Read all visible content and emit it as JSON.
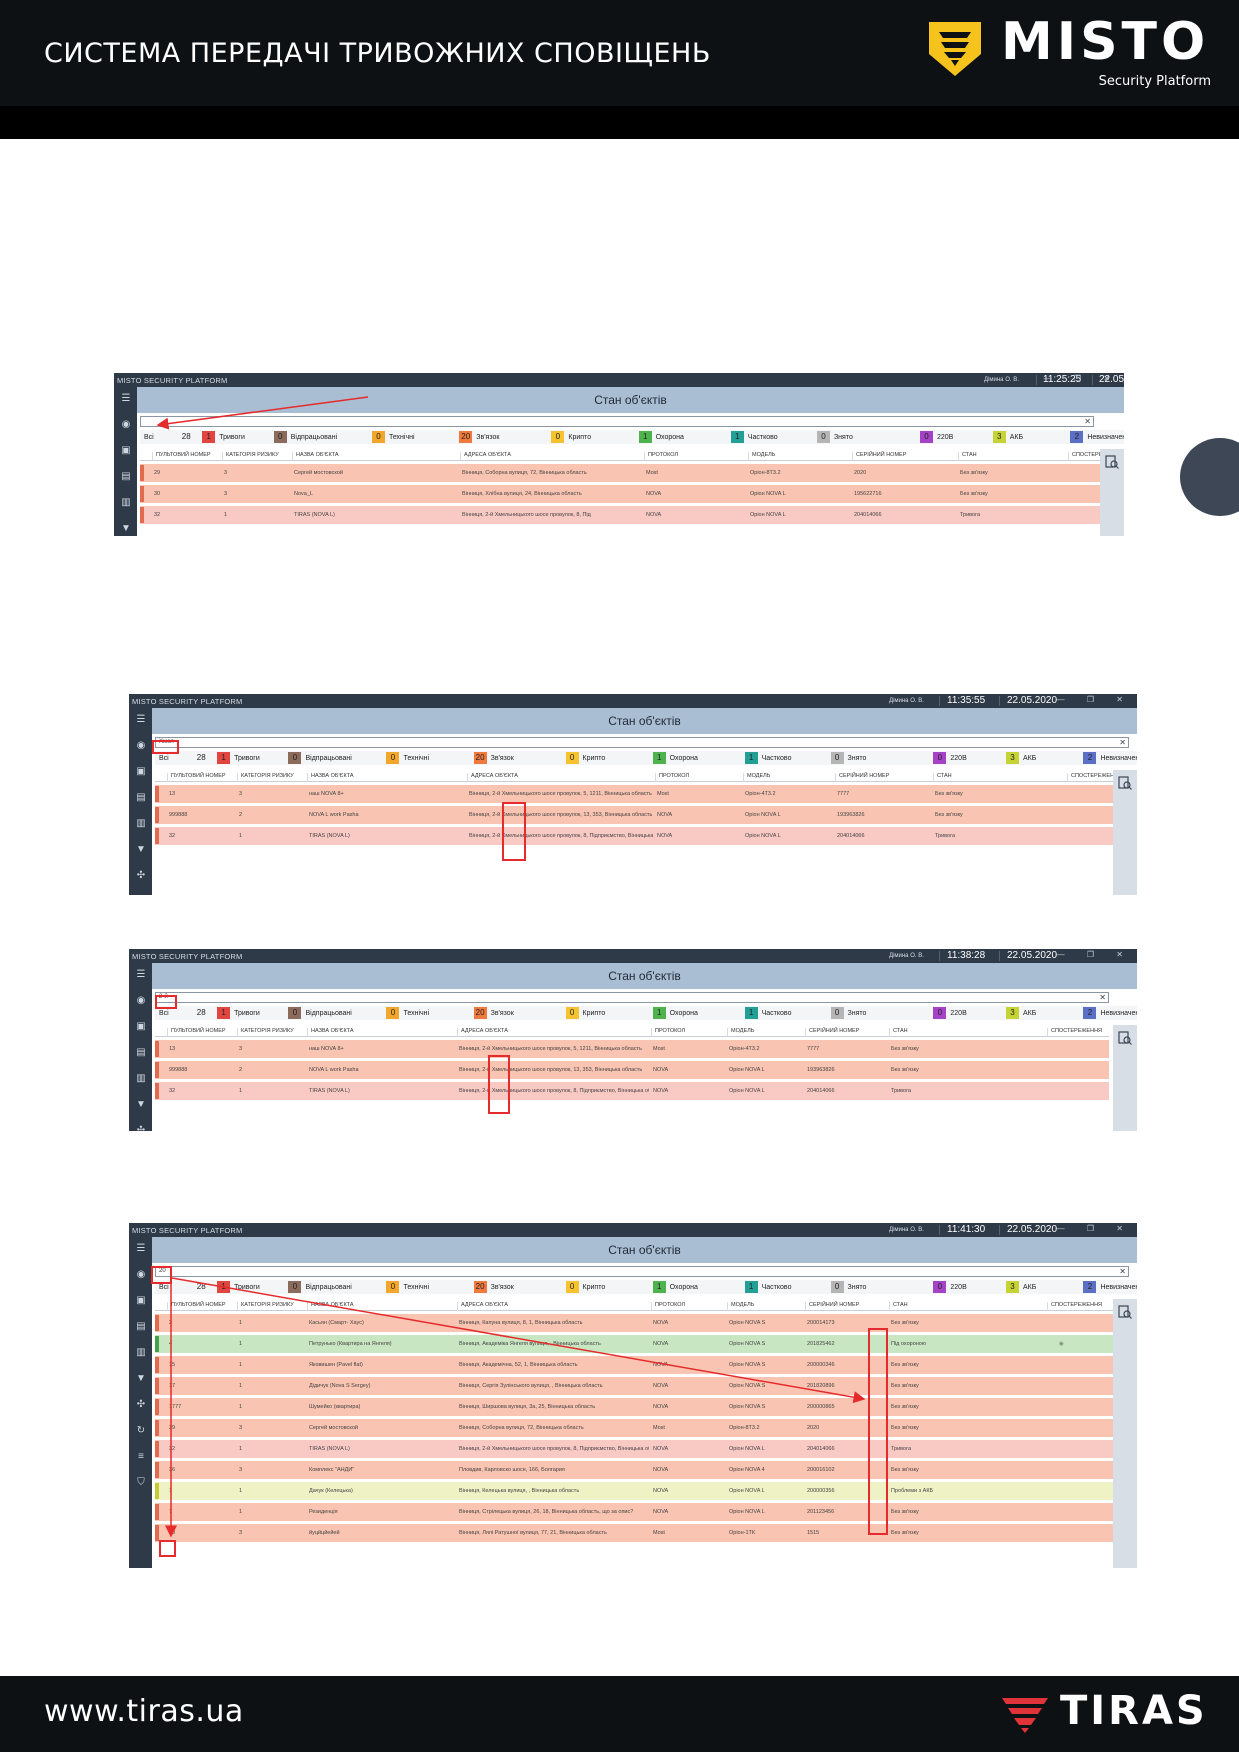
{
  "header": {
    "title": "СИСТЕМА ПЕРЕДАЧІ ТРИВОЖНИХ СПОВІЩЕНЬ",
    "brand": "MISTO",
    "brand_sub": "Security Platform"
  },
  "footer": {
    "url": "www.tiras.ua",
    "brand": "TIRAS"
  },
  "app_common": {
    "app_name": "MISTO SECURITY PLATFORM",
    "user": "Дімина О. В.",
    "date": "22.05.2020",
    "heading": "Стан об'єктів",
    "window_buttons": "— ❐ ✕",
    "clear_icon": "✕",
    "counters": [
      {
        "label": "Всі",
        "value": "28",
        "color": "#f3f5f7"
      },
      {
        "label": "Тривоги",
        "value": "1",
        "color": "#e0453f"
      },
      {
        "label": "Відпрацьовані",
        "value": "0",
        "color": "#8a6b5c"
      },
      {
        "label": "Технічні",
        "value": "0",
        "color": "#f2a62b"
      },
      {
        "label": "Зв'язок",
        "value": "20",
        "color": "#f07a3e"
      },
      {
        "label": "Крипто",
        "value": "0",
        "color": "#f6c22e"
      },
      {
        "label": "Охорона",
        "value": "1",
        "color": "#4fb34d"
      },
      {
        "label": "Частково",
        "value": "1",
        "color": "#22a096"
      },
      {
        "label": "Знято",
        "value": "0",
        "color": "#b5b5b5"
      },
      {
        "label": "220В",
        "value": "0",
        "color": "#a543c7"
      },
      {
        "label": "АКБ",
        "value": "3",
        "color": "#c5d334"
      },
      {
        "label": "Невизначено",
        "value": "2",
        "color": "#5b6fc5"
      }
    ],
    "columns": [
      "ПУЛЬТОВИЙ НОМЕР",
      "КАТЕГОРІЯ РИЗИКУ",
      "НАЗВА ОБ'ЄКТА",
      "АДРЕСА ОБ'ЄКТА",
      "ПРОТОКОЛ",
      "МОДЕЛЬ",
      "СЕРІЙНИЙ НОМЕР",
      "СТАН",
      "СПОСТЕРЕЖЕННЯ"
    ]
  },
  "screens": [
    {
      "time": "11:25:25",
      "search": "",
      "rows": [
        {
          "num": "29",
          "risk": "3",
          "name": "Сергей мостовской",
          "addr": "Вінниця, Соборна вулиця, 72, Вінницька область",
          "proto": "Most",
          "model": "Оріон-8Т3.2",
          "serial": "2020",
          "state": "Без зв'язку",
          "type": "noconn"
        },
        {
          "num": "30",
          "risk": "3",
          "name": "Nova_L",
          "addr": "Вінниця, Хлібна вулиця, 24, Вінницька область",
          "proto": "NOVA",
          "model": "Оріон NOVA L",
          "serial": "195622716",
          "state": "Без зв'язку",
          "type": "noconn"
        },
        {
          "num": "32",
          "risk": "1",
          "name": "TIRAS (NOVA L)",
          "addr": "Вінниця, 2-й Хмельницького шосе провулок, 8, Під",
          "proto": "NOVA",
          "model": "Оріон NOVA L",
          "serial": "204014066",
          "state": "Тривога",
          "type": "alarm"
        }
      ]
    },
    {
      "time": "11:35:55",
      "search": "Хмел",
      "rows": [
        {
          "num": "13",
          "risk": "3",
          "name": "наш NOVA 8+",
          "addr": "Вінниця, 2-й Хмельницького шосе провулок, 5, 1211, Вінницька область",
          "proto": "Most",
          "model": "Оріон-4Т3.2",
          "serial": "7777",
          "state": "Без зв'язку",
          "type": "noconn"
        },
        {
          "num": "999888",
          "risk": "2",
          "name": "NOVA L work Pasha",
          "addr": "Вінниця, 2-й Хмельницького шосе провулок, 13, 353, Вінницька область",
          "proto": "NOVA",
          "model": "Оріон NOVA L",
          "serial": "193963826",
          "state": "Без зв'язку",
          "type": "noconn"
        },
        {
          "num": "32",
          "risk": "1",
          "name": "TIRAS (NOVA L)",
          "addr": "Вінниця, 2-й Хмельницького шосе провулок, 8, Підприємство, Вінницька об",
          "proto": "NOVA",
          "model": "Оріон NOVA L",
          "serial": "204014066",
          "state": "Тривога",
          "type": "alarm"
        }
      ]
    },
    {
      "time": "11:38:28",
      "search": "2-й",
      "rows": [
        {
          "num": "13",
          "risk": "3",
          "name": "наш NOVA 8+",
          "addr": "Вінниця, 2-й Хмельницького шосе провулок, 5, 1211, Вінницька область",
          "proto": "Most",
          "model": "Оріон-4Т3.2",
          "serial": "7777",
          "state": "Без зв'язку",
          "type": "noconn"
        },
        {
          "num": "999888",
          "risk": "2",
          "name": "NOVA L work Pasha",
          "addr": "Вінниця, 2-й Хмельницького шосе провулок, 13, 353, Вінницька область",
          "proto": "NOVA",
          "model": "Оріон NOVA L",
          "serial": "193963826",
          "state": "Без зв'язку",
          "type": "noconn"
        },
        {
          "num": "32",
          "risk": "1",
          "name": "TIRAS (NOVA L)",
          "addr": "Вінниця, 2-й Хмельницького шосе провулок, 8, Підприємство, Вінницька об",
          "proto": "NOVA",
          "model": "Оріон NOVA L",
          "serial": "204014066",
          "state": "Тривога",
          "type": "alarm"
        }
      ]
    },
    {
      "time": "11:41:30",
      "search": "20",
      "rows": [
        {
          "num": "2",
          "risk": "1",
          "name": "Касьян (Смарт- Хаус)",
          "addr": "Вінниця, Капуна вулиця, 8, 1, Вінницька область",
          "proto": "NOVA",
          "model": "Оріон NOVA S",
          "serial": "200014173",
          "state": "Без зв'язку",
          "type": "noconn"
        },
        {
          "num": "4",
          "risk": "1",
          "name": "Петрунько (Квартира на Янгеля)",
          "addr": "Вінниця, Академіка Янгеля вулиця, , Вінницька область",
          "proto": "NOVA",
          "model": "Оріон NOVA S",
          "serial": "201825462",
          "state": "Під охороною",
          "type": "guard"
        },
        {
          "num": "15",
          "risk": "1",
          "name": "Яковишен (Pavel flat)",
          "addr": "Вінниця, Академічна, 52, 1, Вінницька область",
          "proto": "NOVA",
          "model": "Оріон NOVA S",
          "serial": "200000346",
          "state": "Без зв'язку",
          "type": "noconn"
        },
        {
          "num": "17",
          "risk": "1",
          "name": "Дідичук (Nova S Sergey)",
          "addr": "Вінниця, Сергія Зулінського вулиця, , Вінницька область",
          "proto": "NOVA",
          "model": "Оріон NOVA S",
          "serial": "201820896",
          "state": "Без зв'язку",
          "type": "noconn"
        },
        {
          "num": "1777",
          "risk": "1",
          "name": "Шумейко (квартира)",
          "addr": "Вінниця, Ширшова вулиця, 3а, 25, Вінницька область",
          "proto": "NOVA",
          "model": "Оріон NOVA S",
          "serial": "200000865",
          "state": "Без зв'язку",
          "type": "noconn"
        },
        {
          "num": "29",
          "risk": "3",
          "name": "Сергей мостовской",
          "addr": "Вінниця, Соборна вулиця, 72, Вінницька область",
          "proto": "Most",
          "model": "Оріон-8Т3.2",
          "serial": "2020",
          "state": "Без зв'язку",
          "type": "noconn"
        },
        {
          "num": "32",
          "risk": "1",
          "name": "TIRAS (NOVA L)",
          "addr": "Вінниця, 2-й Хмельницького шосе провулок, 8, Підприємство, Вінницька об",
          "proto": "NOVA",
          "model": "Оріон NOVA L",
          "serial": "204014066",
          "state": "Тривога",
          "type": "alarm"
        },
        {
          "num": "36",
          "risk": "3",
          "name": "Комплекс \"АНДИ\"",
          "addr": "Пловдив, Карловско шосе, 166, Болгария",
          "proto": "NOVA",
          "model": "Оріон NOVA 4",
          "serial": "200016102",
          "state": "Без зв'язку",
          "type": "noconn"
        },
        {
          "num": "1",
          "risk": "1",
          "name": "Дачук (Келецька)",
          "addr": "Вінниця, Келецька вулиця, , Вінницька область",
          "proto": "NOVA",
          "model": "Оріон NOVA L",
          "serial": "200000356",
          "state": "Проблеми з АКБ",
          "type": "akb"
        },
        {
          "num": "7",
          "risk": "1",
          "name": "Резиденція",
          "addr": "Вінниця, Стрілецька вулиця, 26, 18, Вінницька область, що за опис?",
          "proto": "NOVA",
          "model": "Оріон NOVA L",
          "serial": "201123456",
          "state": "Без зв'язку",
          "type": "noconn"
        },
        {
          "num": "20",
          "risk": "3",
          "name": "йуцйцйейей",
          "addr": "Вінниця, Лялі Ратушної вулиця, 77, 21, Вінницька область",
          "proto": "Most",
          "model": "Оріон-1ТК",
          "serial": "1515",
          "state": "Без зв'язку",
          "type": "noconn"
        }
      ]
    }
  ]
}
